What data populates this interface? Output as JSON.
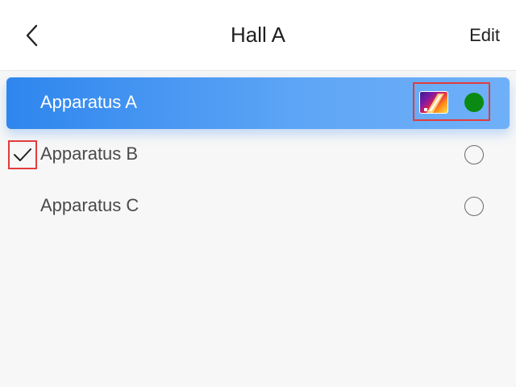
{
  "header": {
    "title": "Hall A",
    "edit_label": "Edit"
  },
  "list": {
    "items": [
      {
        "label": "Apparatus A",
        "selected": true,
        "status": "active",
        "status_color": "#0a8a12"
      },
      {
        "label": "Apparatus B",
        "checked": true
      },
      {
        "label": "Apparatus C"
      }
    ]
  },
  "icons": {
    "back": "chevron-left-icon",
    "thermal": "thermal-image-icon",
    "check": "check-icon"
  },
  "colors": {
    "accent": "#2f86ee",
    "highlight_border": "#e23c3c"
  }
}
